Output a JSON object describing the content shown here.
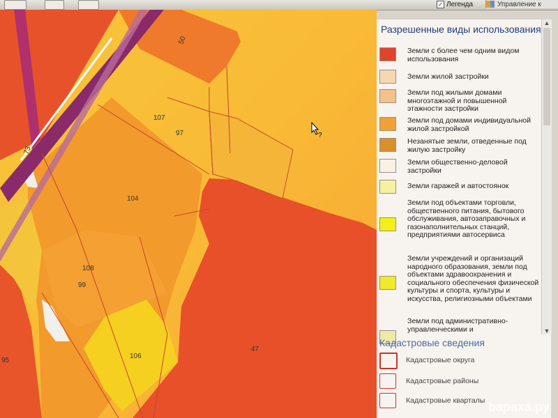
{
  "toolbar": {
    "legend_label": "Легенда",
    "legend_checked": true,
    "management_label": "Управление к"
  },
  "map": {
    "labels": [
      "50",
      "107",
      "97",
      "73",
      "104",
      "108",
      "99",
      "106",
      "47",
      "95"
    ],
    "colors": {
      "mixed_use": "#e8502a",
      "individual_housing": "#f4a532",
      "residential": "#f7b93e",
      "garages": "#f7e84a",
      "roads": "#a8306a"
    }
  },
  "legend": {
    "title": "Разрешенные виды использования",
    "items": [
      {
        "label": "Земли с более чем одним видом использования",
        "color": "#e1442c"
      },
      {
        "label": "Земли жилой застройки",
        "color": "#f6d7b2"
      },
      {
        "label": "Земли под жилыми домами многоэтажной и повышенной этажности застройки",
        "color": "#f2c28c"
      },
      {
        "label": "Земли под домами индивидуальной жилой застройкой",
        "color": "#f0a134"
      },
      {
        "label": "Незанятые земли, отведенные под жилую застройку",
        "color": "#d98f2a"
      },
      {
        "label": "Земли общественно-деловой застройки",
        "color": "#f9f1e4"
      },
      {
        "label": "Земли гаражей и автостоянок",
        "color": "#f6f0a2"
      },
      {
        "label": "Земли под объектами торговли, общественного питания, бытового обслуживания, автозаправочных и газонаполнительных станций, предприятиями автосервиса",
        "color": "#f3f016"
      },
      {
        "label": "Земли учреждений и организаций народного образования, земли под объектами здравоохранения и социального обеспечения физической культуры и спорта, культуры и искусства, религиозными объектами",
        "color": "#efea2a"
      },
      {
        "label": "Земли под административно-управленческими и",
        "color": "#efe9a8"
      }
    ]
  },
  "cadastre": {
    "title": "Кадастровые сведения",
    "items": [
      {
        "label": "Кадастровые округа"
      },
      {
        "label": "Кадастровые районы"
      },
      {
        "label": "Кадастровые кварталы"
      }
    ]
  },
  "watermark": "bараха.ру"
}
